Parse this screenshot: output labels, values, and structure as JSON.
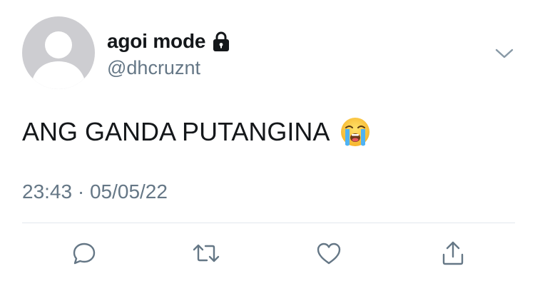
{
  "tweet": {
    "display_name": "agoi mode",
    "handle": "@dhcruznt",
    "text": "ANG GANDA PUTANGINA",
    "timestamp": "23:43 · 05/05/22",
    "icons": {
      "avatar": "default-avatar-icon",
      "protected": "lock-icon",
      "more": "chevron-down-icon",
      "emoji": "loudly-crying-face-emoji"
    }
  },
  "actions": [
    {
      "name": "reply",
      "icon": "reply-icon"
    },
    {
      "name": "retweet",
      "icon": "retweet-icon"
    },
    {
      "name": "like",
      "icon": "heart-icon"
    },
    {
      "name": "share",
      "icon": "share-icon"
    }
  ],
  "colors": {
    "text": "#14171a",
    "secondary": "#657786",
    "avatar_bg": "#cdcdd1",
    "icon_gray": "#657786",
    "divider": "#e1e8ed"
  }
}
